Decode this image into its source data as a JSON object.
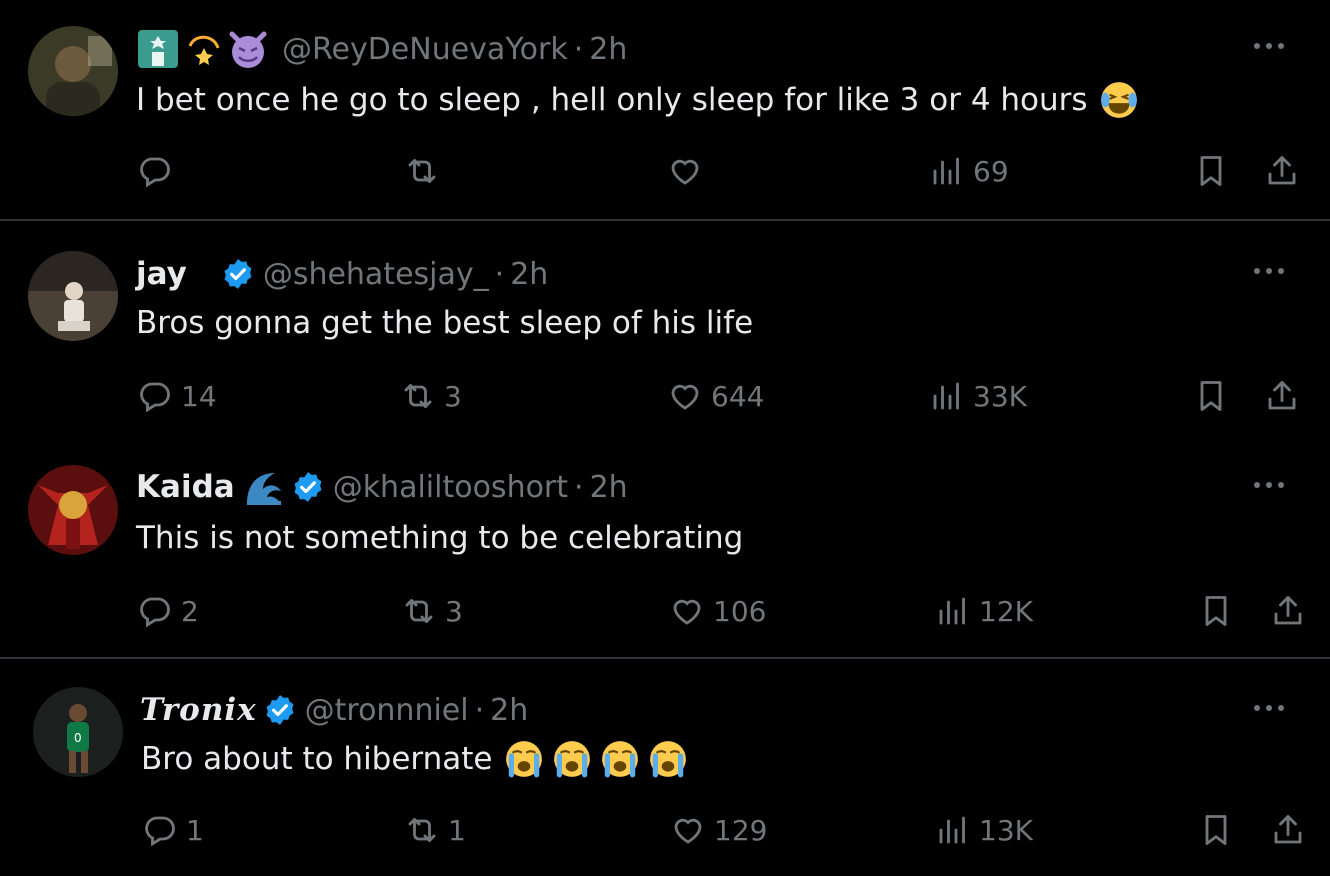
{
  "colors": {
    "background": "#000000",
    "text": "#e7e9ea",
    "muted": "#71767b",
    "verified": "#1d9bf0",
    "divider": "#2f3336"
  },
  "tweets": [
    {
      "name": "",
      "badges": [
        "statue-of-liberty-emoji",
        "dizzy-emoji",
        "smiling-devil-emoji"
      ],
      "handle": "@ReyDeNuevaYork",
      "sep": "·",
      "time": "2h",
      "text": "I bet once he go to sleep , hell only sleep for like 3 or 4 hours",
      "text_emoji": "face-with-tears-of-joy",
      "replies": "",
      "retweets": "",
      "likes": "",
      "views": "69"
    },
    {
      "name": "jay",
      "verified": true,
      "handle": "@shehatesjay_",
      "sep": "·",
      "time": "2h",
      "text": "Bros gonna get the best sleep of his life",
      "replies": "14",
      "retweets": "3",
      "likes": "644",
      "views": "33K"
    },
    {
      "name": "Kaida",
      "name_emoji": "water-wave-emoji",
      "verified": true,
      "handle": "@khaliltooshort",
      "sep": "·",
      "time": "2h",
      "text": "This is not something to be celebrating",
      "replies": "2",
      "retweets": "3",
      "likes": "106",
      "views": "12K"
    },
    {
      "name": "Tronix",
      "verified": true,
      "handle": "@tronnniel",
      "sep": "·",
      "time": "2h",
      "text": "Bro about to hibernate",
      "text_emoji": "loudly-crying-face x4",
      "replies": "1",
      "retweets": "1",
      "likes": "129",
      "views": "13K"
    }
  ]
}
